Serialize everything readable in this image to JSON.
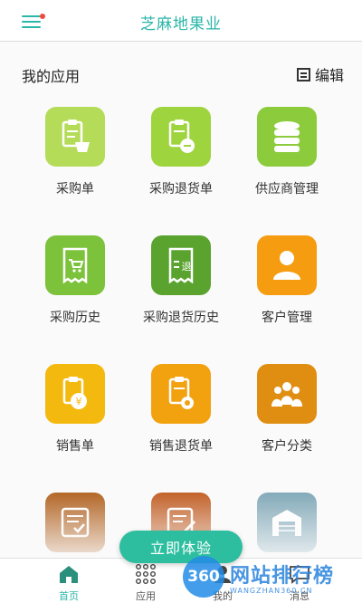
{
  "header": {
    "title": "芝麻地果业"
  },
  "section": {
    "title": "我的应用",
    "edit_label": "编辑"
  },
  "apps": [
    {
      "label": "采购单",
      "icon": "clipboard-basket-icon",
      "color": "#b5dc59"
    },
    {
      "label": "采购退货单",
      "icon": "clipboard-coin-icon",
      "color": "#9ed43e"
    },
    {
      "label": "供应商管理",
      "icon": "database-icon",
      "color": "#8ccb3c"
    },
    {
      "label": "采购历史",
      "icon": "receipt-cart-icon",
      "color": "#7cc23a"
    },
    {
      "label": "采购退货历史",
      "icon": "receipt-return-icon",
      "color": "#5aa32e"
    },
    {
      "label": "客户管理",
      "icon": "person-icon",
      "color": "#f59c10"
    },
    {
      "label": "销售单",
      "icon": "clipboard-yen-icon",
      "color": "#f4b90f"
    },
    {
      "label": "销售退货单",
      "icon": "clipboard-return-icon",
      "color": "#f2a10f"
    },
    {
      "label": "客户分类",
      "icon": "group-icon",
      "color": "#e08e12"
    },
    {
      "label": "",
      "icon": "checklist-icon",
      "color": "#b0601e"
    },
    {
      "label": "",
      "icon": "checklist-pen-icon",
      "color": "#c05c22"
    },
    {
      "label": "",
      "icon": "warehouse-icon",
      "color": "#7ea6b6"
    }
  ],
  "cta": {
    "label": "立即体验"
  },
  "tabs": [
    {
      "label": "首页",
      "icon": "home-icon",
      "active": true
    },
    {
      "label": "应用",
      "icon": "grid-dots-icon",
      "active": false
    },
    {
      "label": "我的",
      "icon": "user-icon",
      "active": false
    },
    {
      "label": "消息",
      "icon": "message-icon",
      "active": false
    }
  ],
  "watermark": {
    "badge": "360",
    "text": "网站排行榜",
    "sub": "WANGZHAN360.CN"
  },
  "colors": {
    "accent": "#2ab6a8",
    "cta": "#2dbea0"
  }
}
